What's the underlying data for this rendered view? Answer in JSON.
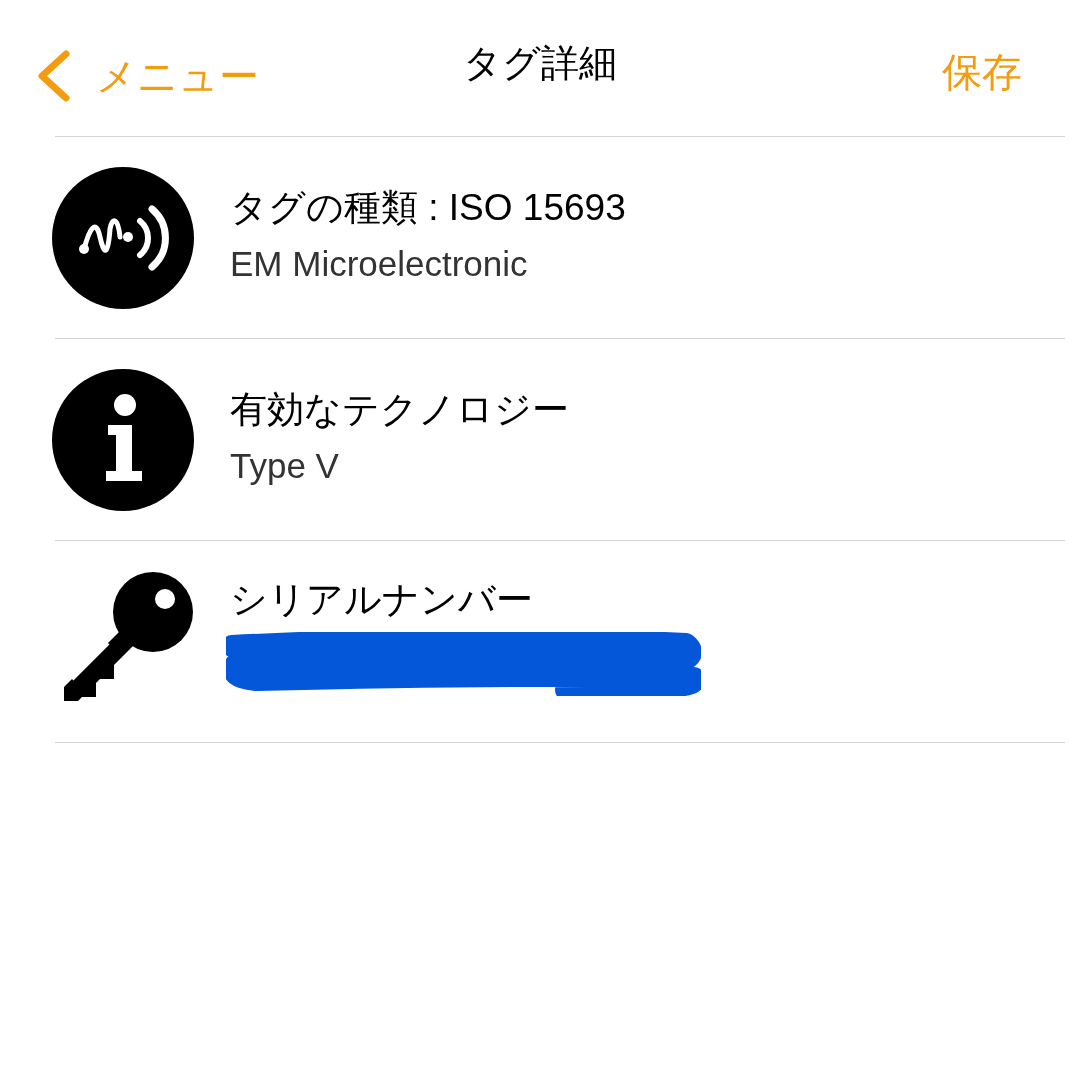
{
  "nav": {
    "back": "メニュー",
    "title": "タグ詳細",
    "action": "保存"
  },
  "rows": [
    {
      "kind": "text",
      "title": "タグの種類 : ISO 15693",
      "subtitle": "EM Microelectronic"
    },
    {
      "kind": "text",
      "title": "有効なテクノロジー",
      "subtitle": "Type V"
    },
    {
      "kind": "redacted",
      "title": "シリアルナンバー"
    }
  ]
}
